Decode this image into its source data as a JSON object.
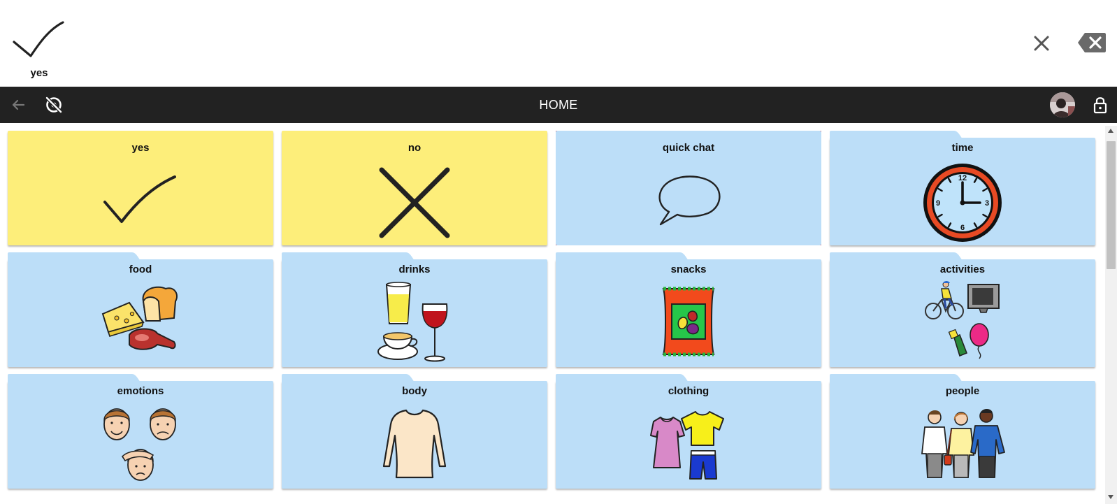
{
  "output_bar": {
    "symbol": {
      "label": "yes",
      "icon": "checkmark-icon"
    },
    "clear_icon": "close-icon",
    "backspace_icon": "backspace-icon"
  },
  "navbar": {
    "title": "HOME",
    "back_icon": "arrow-left-icon",
    "scan_icon": "scan-off-icon",
    "avatar_icon": "user-avatar",
    "lock_icon": "lock-icon",
    "bg_color": "#222222"
  },
  "tiles": [
    {
      "label": "yes",
      "icon": "checkmark-icon",
      "color": "yellow",
      "folder": false
    },
    {
      "label": "no",
      "icon": "cross-icon",
      "color": "yellow",
      "folder": false
    },
    {
      "label": "quick chat",
      "icon": "speech-bubble-icon",
      "color": "blue",
      "folder": false,
      "selected": true
    },
    {
      "label": "time",
      "icon": "clock-icon",
      "color": "blue",
      "folder": true
    },
    {
      "label": "food",
      "icon": "food-icon",
      "color": "blue",
      "folder": true
    },
    {
      "label": "drinks",
      "icon": "drinks-icon",
      "color": "blue",
      "folder": true
    },
    {
      "label": "snacks",
      "icon": "snacks-icon",
      "color": "blue",
      "folder": true
    },
    {
      "label": "activities",
      "icon": "activities-icon",
      "color": "blue",
      "folder": true
    },
    {
      "label": "emotions",
      "icon": "emotions-icon",
      "color": "blue",
      "folder": true
    },
    {
      "label": "body",
      "icon": "body-icon",
      "color": "blue",
      "folder": true
    },
    {
      "label": "clothing",
      "icon": "clothing-icon",
      "color": "blue",
      "folder": true
    },
    {
      "label": "people",
      "icon": "people-icon",
      "color": "blue",
      "folder": true
    }
  ],
  "colors": {
    "tile_yellow": "#fdee7a",
    "tile_blue": "#bcdef8",
    "selection_outline": "#e1111b"
  }
}
